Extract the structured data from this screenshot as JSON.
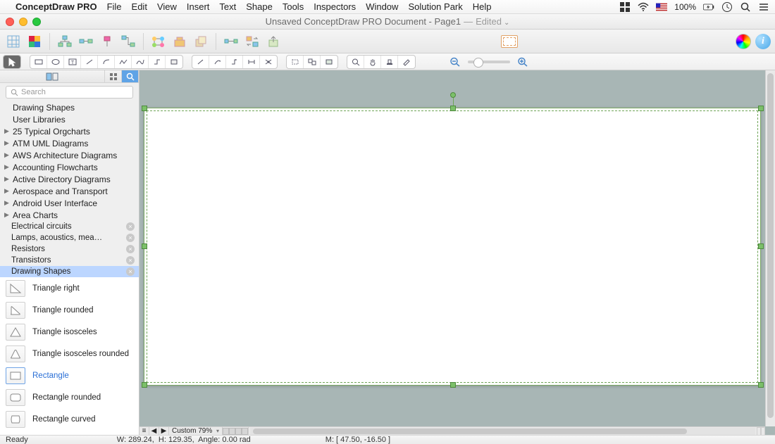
{
  "menubar": {
    "app": "ConceptDraw PRO",
    "items": [
      "File",
      "Edit",
      "View",
      "Insert",
      "Text",
      "Shape",
      "Tools",
      "Inspectors",
      "Window",
      "Solution Park",
      "Help"
    ],
    "battery": "100%"
  },
  "titlebar": {
    "doc": "Unsaved ConceptDraw PRO Document - Page1",
    "dash": "—",
    "state": "Edited"
  },
  "sidebar": {
    "search_placeholder": "Search",
    "static": [
      "Drawing Shapes",
      "User Libraries"
    ],
    "categories": [
      "25 Typical Orgcharts",
      "ATM UML Diagrams",
      "AWS Architecture Diagrams",
      "Accounting Flowcharts",
      "Active Directory Diagrams",
      "Aerospace and Transport",
      "Android User Interface",
      "Area Charts"
    ],
    "sublibs": [
      {
        "label": "Electrical circuits",
        "selected": false
      },
      {
        "label": "Lamps, acoustics, mea…",
        "selected": false
      },
      {
        "label": "Resistors",
        "selected": false
      },
      {
        "label": "Transistors",
        "selected": false
      },
      {
        "label": "Drawing Shapes",
        "selected": true
      }
    ],
    "shapes": [
      {
        "label": "Triangle right",
        "sel": false,
        "svg": "tr"
      },
      {
        "label": "Triangle rounded",
        "sel": false,
        "svg": "trr"
      },
      {
        "label": "Triangle isosceles",
        "sel": false,
        "svg": "ti"
      },
      {
        "label": "Triangle isosceles rounded",
        "sel": false,
        "svg": "tir"
      },
      {
        "label": "Rectangle",
        "sel": true,
        "svg": "rect"
      },
      {
        "label": "Rectangle rounded",
        "sel": false,
        "svg": "rectr"
      },
      {
        "label": "Rectangle curved",
        "sel": false,
        "svg": "rectc"
      }
    ]
  },
  "canvas": {
    "zoom_label": "Custom 79%"
  },
  "status": {
    "ready": "Ready",
    "dims": "W: 289.24,  H: 129.35,  Angle: 0.00 rad",
    "mouse": "M: [ 47.50, -16.50 ]"
  }
}
